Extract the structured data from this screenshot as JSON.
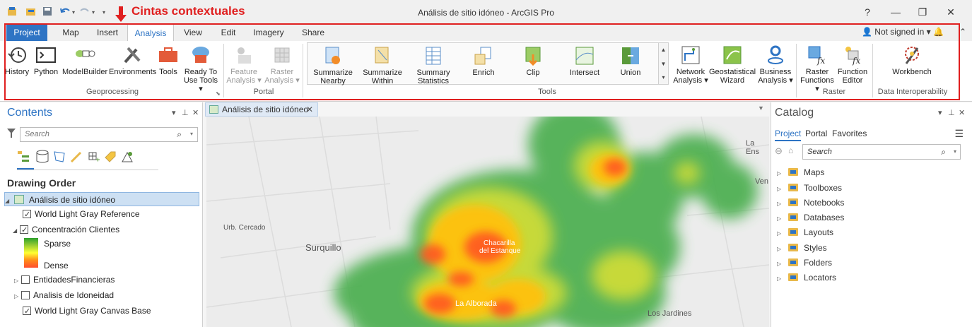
{
  "window": {
    "title": "Análisis de sitio idóneo - ArcGIS Pro",
    "annotation": "Cintas contextuales",
    "help": "?",
    "minimize": "—",
    "restore": "❐",
    "close": "✕"
  },
  "tabs": [
    {
      "label": "Project"
    },
    {
      "label": "Map"
    },
    {
      "label": "Insert"
    },
    {
      "label": "Analysis"
    },
    {
      "label": "View"
    },
    {
      "label": "Edit"
    },
    {
      "label": "Imagery"
    },
    {
      "label": "Share"
    }
  ],
  "account": {
    "signin": "Not signed in ▾"
  },
  "ribbon": {
    "geoprocessing": {
      "label": "Geoprocessing",
      "buttons": [
        "History",
        "Python",
        "ModelBuilder",
        "Environments",
        "Tools",
        "Ready To Use Tools ▾"
      ]
    },
    "portal": {
      "label": "Portal",
      "buttons": [
        "Feature Analysis ▾",
        "Raster Analysis ▾"
      ]
    },
    "tools": {
      "label": "Tools",
      "buttons": [
        "Summarize Nearby",
        "Summarize Within",
        "Summary Statistics",
        "Enrich",
        "Clip",
        "Intersect",
        "Union"
      ]
    },
    "analysis_extra": {
      "buttons": [
        "Network Analysis ▾",
        "Geostatistical Wizard",
        "Business Analysis ▾"
      ]
    },
    "raster": {
      "label": "Raster",
      "buttons": [
        "Raster Functions ▾",
        "Function Editor"
      ]
    },
    "interop": {
      "label": "Data Interoperability",
      "buttons": [
        "Workbench"
      ]
    }
  },
  "contents": {
    "title": "Contents",
    "search_placeholder": "Search",
    "drawing_order": "Drawing Order",
    "map_name": "Análisis de sitio idóneo",
    "layers": {
      "ref": "World Light Gray Reference",
      "conc": "Concentración Clientes",
      "sparse": "Sparse",
      "dense": "Dense",
      "entidades": "EntidadesFinancieras",
      "idoneidad": "Analisis de Idoneidad",
      "base": "World Light Gray Canvas Base"
    }
  },
  "map": {
    "tab_label": "Análisis de sitio idóneo",
    "places": {
      "la_ens": "La Ens",
      "ven": "Ven",
      "cercado": "Urb. Cercado",
      "surquillo": "Surquillo",
      "chacarilla1": "Chacarilla",
      "chacarilla2": "del Estanque",
      "alborada": "La Alborada",
      "jardines": "Los Jardines"
    }
  },
  "catalog": {
    "title": "Catalog",
    "tabs": [
      "Project",
      "Portal",
      "Favorites"
    ],
    "search_placeholder": "Search",
    "items": [
      "Maps",
      "Toolboxes",
      "Notebooks",
      "Databases",
      "Layouts",
      "Styles",
      "Folders",
      "Locators"
    ]
  }
}
